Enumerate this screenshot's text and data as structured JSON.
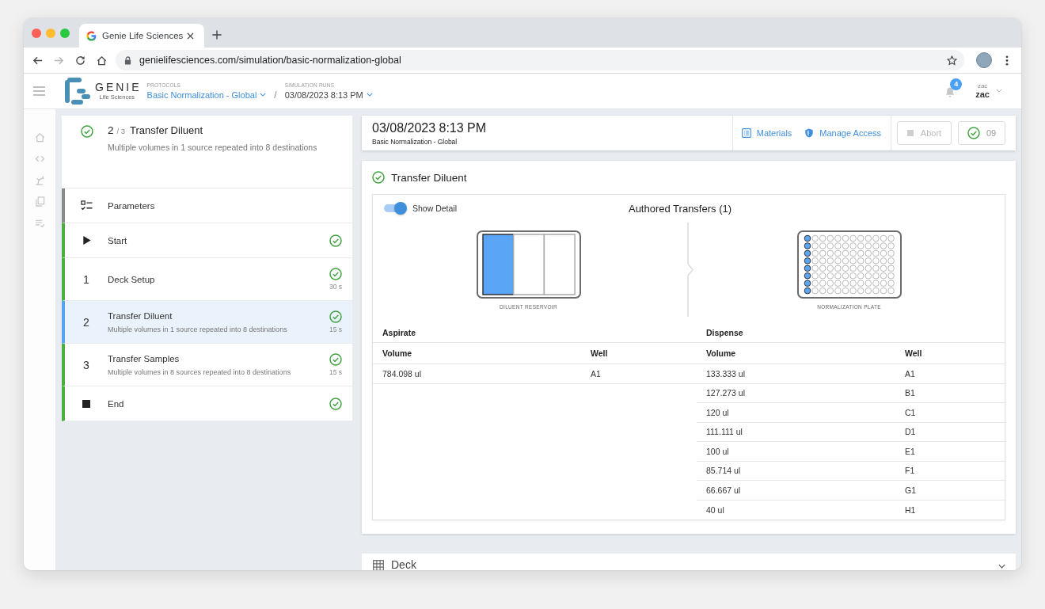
{
  "browser": {
    "tab": {
      "title": "Genie Life Sciences"
    },
    "url": "genielifesciences.com/simulation/basic-normalization-global"
  },
  "header": {
    "brand": {
      "name": "GENIE",
      "tagline": "Life Sciences"
    },
    "breadcrumbs": [
      {
        "label": "PROTOCOLS",
        "value": "Basic Normalization - Global",
        "kind": "link"
      },
      {
        "label": "SIMULATION RUNS",
        "value": "03/08/2023 8:13 PM",
        "kind": "plain"
      }
    ],
    "separator": "/",
    "notifications": {
      "badge": "4"
    },
    "user": {
      "caption": "zac",
      "name": "zac"
    }
  },
  "current_step": {
    "complete": true,
    "number": "2",
    "total": "/ 3",
    "title": "Transfer Diluent",
    "description": "Multiple volumes in 1 source repeated into 8 destinations"
  },
  "steps": [
    {
      "kind": "parameters",
      "title": "Parameters",
      "complete": false,
      "selected": false
    },
    {
      "kind": "start",
      "title": "Start",
      "complete": true,
      "selected": false
    },
    {
      "kind": "numbered",
      "number": "1",
      "title": "Deck Setup",
      "duration": "30 s",
      "complete": true,
      "selected": false
    },
    {
      "kind": "numbered",
      "number": "2",
      "title": "Transfer Diluent",
      "description": "Multiple volumes in 1 source repeated into 8 destinations",
      "duration": "15 s",
      "complete": true,
      "selected": true
    },
    {
      "kind": "numbered",
      "number": "3",
      "title": "Transfer Samples",
      "description": "Multiple volumes in 8 sources repeated into 8 destinations",
      "duration": "15 s",
      "complete": true,
      "selected": false
    },
    {
      "kind": "end",
      "title": "End",
      "complete": true,
      "selected": false
    }
  ],
  "run": {
    "title": "03/08/2023 8:13 PM",
    "subtitle": "Basic Normalization - Global",
    "links": [
      {
        "kind": "materials",
        "label": "Materials"
      },
      {
        "kind": "access",
        "label": "Manage Access"
      }
    ],
    "abort": {
      "label": "Abort",
      "disabled": true
    },
    "confirm": {
      "label": "09"
    }
  },
  "transfer": {
    "title": "Transfer Diluent",
    "complete": true,
    "show_detail": {
      "label": "Show Detail",
      "on": true
    },
    "heading": "Authored Transfers (1)",
    "source": {
      "label": "DILUENT RESERVOIR",
      "troughs": [
        {
          "selected": true
        },
        {
          "selected": false
        },
        {
          "selected": false
        }
      ]
    },
    "destination": {
      "label": "NORMALIZATION PLATE",
      "columns": [
        {
          "selected": true
        },
        {
          "selected": false
        },
        {
          "selected": false
        },
        {
          "selected": false
        },
        {
          "selected": false
        },
        {
          "selected": false
        },
        {
          "selected": false
        },
        {
          "selected": false
        },
        {
          "selected": false
        },
        {
          "selected": false
        },
        {
          "selected": false
        },
        {
          "selected": false
        }
      ]
    },
    "table": {
      "groups": [
        "Aspirate",
        "Dispense"
      ],
      "columns": [
        "Volume",
        "Well",
        "Volume",
        "Well"
      ],
      "aspirate": [
        {
          "volume": "784.098 ul",
          "well": "A1"
        }
      ],
      "dispense": [
        {
          "volume": "133.333 ul",
          "well": "A1"
        },
        {
          "volume": "127.273 ul",
          "well": "B1"
        },
        {
          "volume": "120 ul",
          "well": "C1"
        },
        {
          "volume": "111.111 ul",
          "well": "D1"
        },
        {
          "volume": "100 ul",
          "well": "E1"
        },
        {
          "volume": "85.714 ul",
          "well": "F1"
        },
        {
          "volume": "66.667 ul",
          "well": "G1"
        },
        {
          "volume": "40 ul",
          "well": "H1"
        }
      ]
    }
  },
  "deck": {
    "title": "Deck",
    "expanded": false
  }
}
